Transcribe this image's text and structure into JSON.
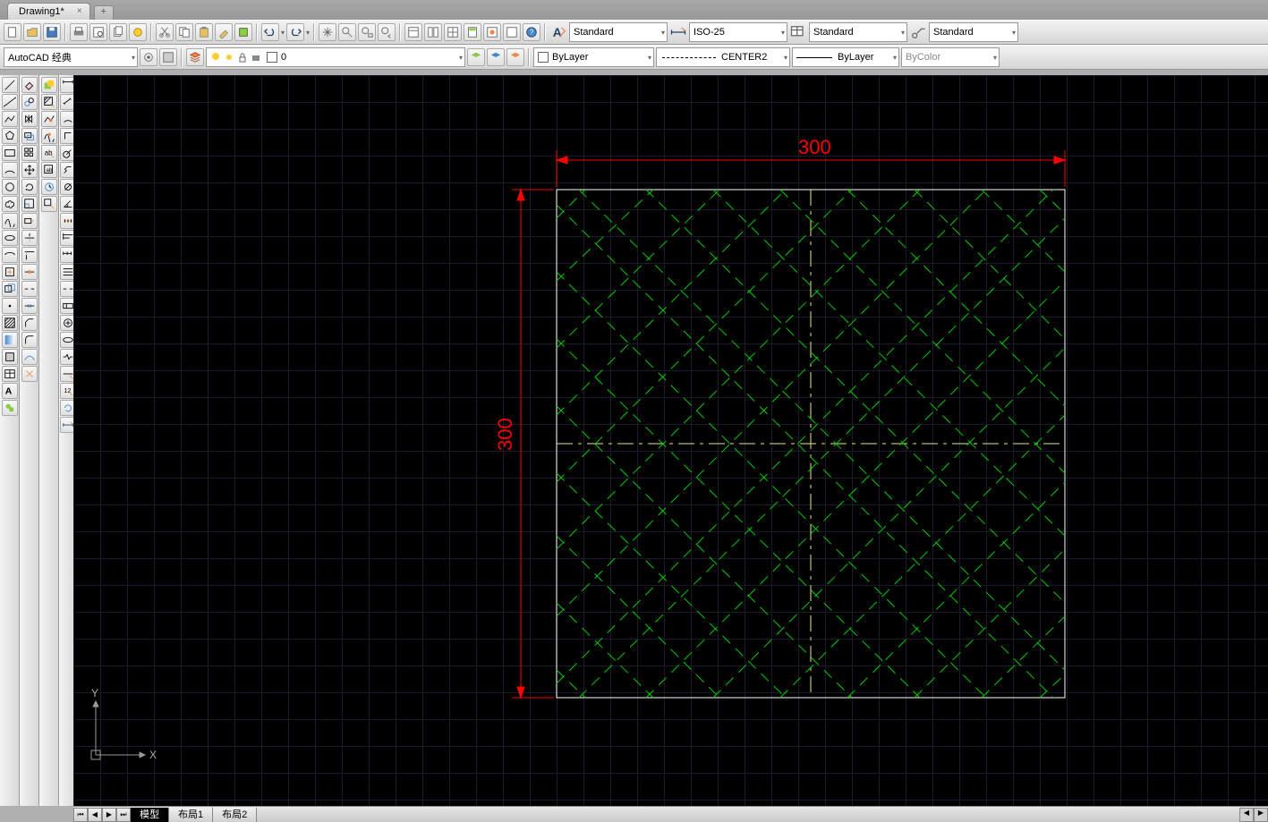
{
  "tab": {
    "title": "Drawing1*",
    "close": "×",
    "new": "+"
  },
  "workspace": {
    "label": "AutoCAD 经典"
  },
  "layer": {
    "current": "0"
  },
  "style_panels": {
    "text_style": "Standard",
    "dim_style": "ISO-25",
    "table_style": "Standard",
    "mleader_style": "Standard"
  },
  "properties": {
    "color": "ByLayer",
    "linetype": "CENTER2",
    "lineweight": "ByLayer",
    "plotstyle": "ByColor"
  },
  "bottom_tabs": {
    "model": "模型",
    "layout1": "布局1",
    "layout2": "布局2"
  },
  "ucs": {
    "x": "X",
    "y": "Y"
  },
  "dims": {
    "width": "300",
    "height": "300"
  },
  "icons": {
    "new": "new-icon",
    "open": "open-icon",
    "save": "save-icon",
    "print": "print-icon",
    "preview": "preview-icon",
    "publish": "publish-icon",
    "cut": "cut-icon",
    "copy": "copy-icon",
    "paste": "paste-icon",
    "matchprop": "matchprop-icon",
    "blockedit": "blockedit-icon",
    "undo": "undo-icon",
    "redo": "redo-icon",
    "pan": "pan-icon",
    "zoom": "zoom-icon",
    "zoomprev": "zoomprev-icon",
    "zoomwin": "zoomwin-icon",
    "props": "props-icon",
    "sheet": "sheet-icon",
    "toolpal": "toolpal-icon",
    "calc": "calc-icon",
    "markup": "markup-icon",
    "dcenter": "dcenter-icon",
    "help": "help-icon"
  }
}
